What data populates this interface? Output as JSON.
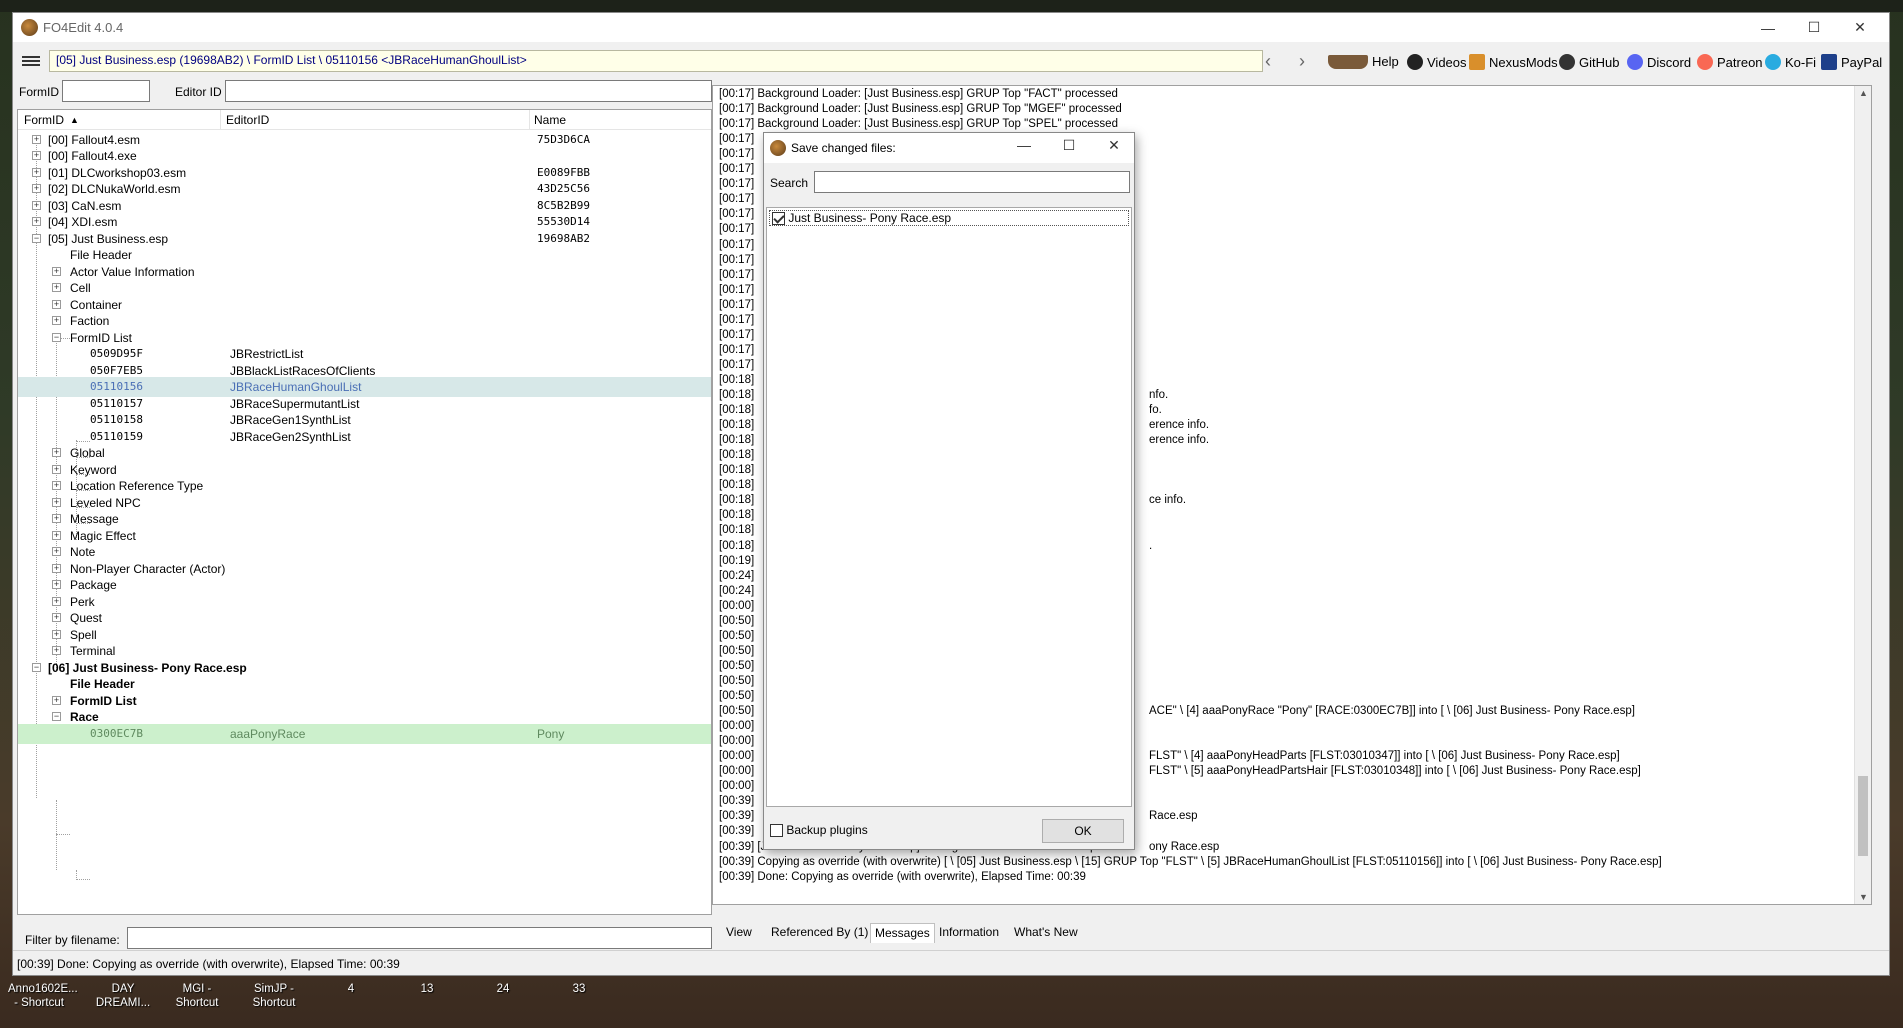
{
  "window": {
    "title": "FO4Edit 4.0.4"
  },
  "path": "[05] Just Business.esp (19698AB2) \\ FormID List \\ 05110156 <JBRaceHumanGhoulList>",
  "toolbar": {
    "help": "Help",
    "videos": "Videos",
    "nexusmods": "NexusMods",
    "github": "GitHub",
    "discord": "Discord",
    "patreon": "Patreon",
    "kofi": "Ko-Fi",
    "paypal": "PayPal"
  },
  "filters": {
    "formid_label": "FormID",
    "editorid_label": "Editor ID",
    "filename_label": "Filter by filename:"
  },
  "tree": {
    "headers": [
      "FormID",
      "EditorID",
      "Name"
    ],
    "rows": [
      {
        "label": "[00] Fallout4.esm",
        "edid": "",
        "name": "75D3D6CA"
      },
      {
        "label": "[00] Fallout4.exe",
        "edid": "",
        "name": ""
      },
      {
        "label": "[01] DLCworkshop03.esm",
        "edid": "",
        "name": "E0089FBB"
      },
      {
        "label": "[02] DLCNukaWorld.esm",
        "edid": "",
        "name": "43D25C56"
      },
      {
        "label": "[03] CaN.esm",
        "edid": "",
        "name": "8C5B2B99"
      },
      {
        "label": "[04] XDI.esm",
        "edid": "",
        "name": "55530D14"
      },
      {
        "label": "[05] Just Business.esp",
        "edid": "",
        "name": "19698AB2"
      },
      {
        "label": "File Header",
        "edid": "",
        "name": ""
      },
      {
        "label": "Actor Value Information",
        "edid": "",
        "name": ""
      },
      {
        "label": "Cell",
        "edid": "",
        "name": ""
      },
      {
        "label": "Container",
        "edid": "",
        "name": ""
      },
      {
        "label": "Faction",
        "edid": "",
        "name": ""
      },
      {
        "label": "FormID List",
        "edid": "",
        "name": ""
      },
      {
        "label": "0509D95F",
        "edid": "JBRestrictList",
        "name": ""
      },
      {
        "label": "050F7EB5",
        "edid": "JBBlackListRacesOfClients",
        "name": ""
      },
      {
        "label": "05110156",
        "edid": "JBRaceHumanGhoulList",
        "name": ""
      },
      {
        "label": "05110157",
        "edid": "JBRaceSupermutantList",
        "name": ""
      },
      {
        "label": "05110158",
        "edid": "JBRaceGen1SynthList",
        "name": ""
      },
      {
        "label": "05110159",
        "edid": "JBRaceGen2SynthList",
        "name": ""
      },
      {
        "label": "Global",
        "edid": "",
        "name": ""
      },
      {
        "label": "Keyword",
        "edid": "",
        "name": ""
      },
      {
        "label": "Location Reference Type",
        "edid": "",
        "name": ""
      },
      {
        "label": "Leveled NPC",
        "edid": "",
        "name": ""
      },
      {
        "label": "Message",
        "edid": "",
        "name": ""
      },
      {
        "label": "Magic Effect",
        "edid": "",
        "name": ""
      },
      {
        "label": "Note",
        "edid": "",
        "name": ""
      },
      {
        "label": "Non-Player Character (Actor)",
        "edid": "",
        "name": ""
      },
      {
        "label": "Package",
        "edid": "",
        "name": ""
      },
      {
        "label": "Perk",
        "edid": "",
        "name": ""
      },
      {
        "label": "Quest",
        "edid": "",
        "name": ""
      },
      {
        "label": "Spell",
        "edid": "",
        "name": ""
      },
      {
        "label": "Terminal",
        "edid": "",
        "name": ""
      },
      {
        "label": "[06] Just Business- Pony Race.esp",
        "edid": "",
        "name": ""
      },
      {
        "label": "File Header",
        "edid": "",
        "name": ""
      },
      {
        "label": "FormID List",
        "edid": "",
        "name": ""
      },
      {
        "label": "Race",
        "edid": "",
        "name": ""
      },
      {
        "label": "0300EC7B",
        "edid": "aaaPonyRace",
        "name": "Pony"
      }
    ]
  },
  "messages": {
    "lines": [
      "[00:17] Background Loader: [Just Business.esp] GRUP Top \"FACT\" processed",
      "[00:17] Background Loader: [Just Business.esp] GRUP Top \"MGEF\" processed",
      "[00:17] Background Loader: [Just Business.esp] GRUP Top \"SPEL\" processed",
      "[00:17]",
      "[00:17]",
      "[00:17]",
      "[00:17]",
      "[00:17]",
      "[00:17]",
      "[00:17]",
      "[00:17]",
      "[00:17]",
      "[00:17]",
      "[00:17]",
      "[00:17]",
      "[00:17]",
      "[00:17]",
      "[00:17]",
      "[00:17]",
      "[00:18]",
      "[00:18]",
      "[00:18]",
      "[00:18]",
      "[00:18]",
      "[00:18]",
      "[00:18]",
      "[00:18]",
      "[00:18]",
      "[00:18]",
      "[00:18]",
      "[00:18]",
      "[00:19]",
      "[00:24]",
      "[00:24]",
      "[00:00]",
      "[00:50]",
      "[00:50]",
      "[00:50]",
      "[00:50]",
      "[00:50]",
      "[00:50]",
      "[00:50]",
      "[00:00]",
      "[00:00]",
      "[00:00]",
      "[00:00]",
      "[00:00]",
      "[00:39]",
      "[00:39]",
      "[00:39]",
      "[00:39] [Just Business- Pony Race.esp] Adding master \"Just Business.esp\"",
      "[00:39] Copying as override (with overwrite) [ \\ [05] Just Business.esp \\ [15] GRUP Top \"FLST\" \\ [5] JBRaceHumanGhoulList [FLST:05110156]] into [ \\ [06] Just Business- Pony Race.esp]",
      "[00:39] Done: Copying as override (with overwrite), Elapsed Time: 00:39"
    ],
    "partial": [
      {
        "line": 20,
        "text": "nfo."
      },
      {
        "line": 21,
        "text": "fo."
      },
      {
        "line": 22,
        "text": "erence info."
      },
      {
        "line": 23,
        "text": "erence info."
      },
      {
        "line": 27,
        "text": "ce info."
      },
      {
        "line": 30,
        "text": "."
      },
      {
        "line": 41,
        "text": "ACE\" \\ [4] aaaPonyRace \"Pony\" [RACE:0300EC7B]] into [ \\ [06] Just Business- Pony Race.esp]"
      },
      {
        "line": 44,
        "text": "FLST\" \\ [4] aaaPonyHeadParts [FLST:03010347]] into [ \\ [06] Just Business- Pony Race.esp]"
      },
      {
        "line": 45,
        "text": "FLST\" \\ [5] aaaPonyHeadPartsHair [FLST:03010348]] into [ \\ [06] Just Business- Pony Race.esp]"
      },
      {
        "line": 48,
        "text": "Race.esp"
      },
      {
        "line": 50,
        "text": "ony Race.esp"
      }
    ]
  },
  "tabs": [
    "View",
    "Referenced By (1)",
    "Messages",
    "Information",
    "What's New"
  ],
  "status": "[00:39] Done: Copying as override (with overwrite), Elapsed Time: 00:39",
  "dialog": {
    "title": "Save changed files:",
    "search_label": "Search",
    "items": [
      {
        "label": "Just Business- Pony Race.esp",
        "checked": true
      }
    ],
    "backup_label": "Backup plugins",
    "ok_label": "OK"
  },
  "desktop": {
    "shortcuts": [
      "Anno1602E... - Shortcut",
      "DAY DREAMI...",
      "MGI - Shortcut",
      "SimJP - Shortcut",
      "4",
      "13",
      "24",
      "33"
    ]
  }
}
